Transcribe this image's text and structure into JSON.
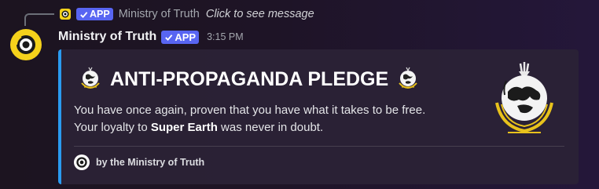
{
  "reply": {
    "app_badge": "APP",
    "author": "Ministry of Truth",
    "preview": "Click to see message"
  },
  "message": {
    "author": "Ministry of Truth",
    "app_badge": "APP",
    "timestamp": "3:15 PM"
  },
  "embed": {
    "accent_color": "#2a9bf0",
    "title": "ANTI-PROPAGANDA PLEDGE",
    "description_line1": "You have once again, proven that you have what it takes to be free.",
    "description_line2_prefix": "Your loyalty to ",
    "description_line2_bold": "Super Earth",
    "description_line2_suffix": " was never in doubt.",
    "footer": "by the Ministry of Truth"
  },
  "icons": {
    "avatar": "ministry-eye-icon",
    "verified": "checkmark-icon",
    "title_emoji": "super-earth-globe-icon",
    "thumbnail": "super-earth-emblem-icon"
  },
  "colors": {
    "avatar_bg": "#f5d21b",
    "app_badge_bg": "#5865f2",
    "emblem_gold": "#e8c21c"
  }
}
